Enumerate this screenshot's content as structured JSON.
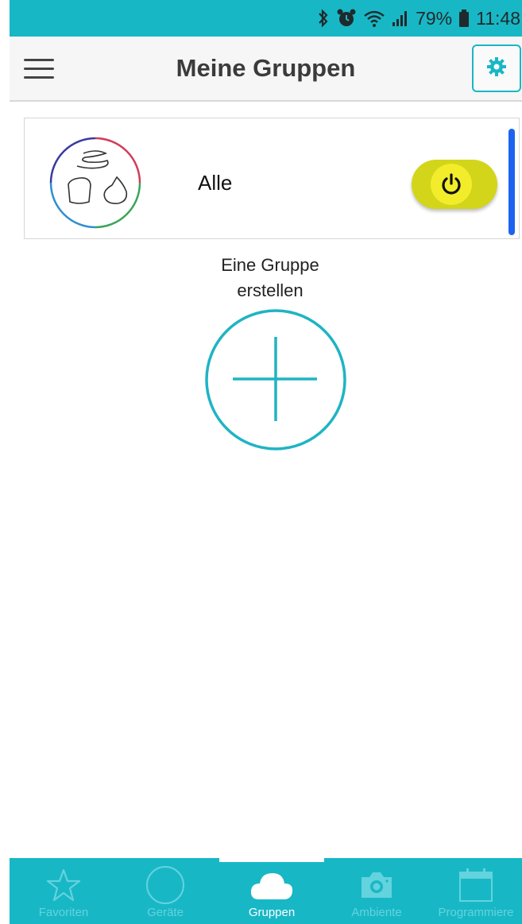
{
  "status_bar": {
    "battery_percent": "79%",
    "time": "11:48",
    "icons": [
      "bluetooth-icon",
      "alarm-icon",
      "wifi-icon",
      "signal-icon",
      "battery-icon"
    ]
  },
  "header": {
    "title": "Meine Gruppen",
    "menu_icon": "hamburger-menu-icon",
    "settings_icon": "gear-icon"
  },
  "groups": [
    {
      "name": "Alle",
      "icon": "lamps-group-icon",
      "power": "on"
    }
  ],
  "create_group": {
    "label_line1": "Eine Gruppe",
    "label_line2": "erstellen",
    "icon": "plus-icon"
  },
  "tabs": [
    {
      "label": "Favoriten",
      "icon": "star-icon",
      "active": false
    },
    {
      "label": "Geräte",
      "icon": "circle-icon",
      "active": false
    },
    {
      "label": "Gruppen",
      "icon": "cloud-icon",
      "active": true
    },
    {
      "label": "Ambiente",
      "icon": "camera-icon",
      "active": false
    },
    {
      "label": "Programmiere",
      "icon": "calendar-icon",
      "active": false
    }
  ],
  "colors": {
    "accent": "#18b7c6",
    "power_on": "#d3d51a",
    "scroll_indicator": "#1d63f0"
  }
}
